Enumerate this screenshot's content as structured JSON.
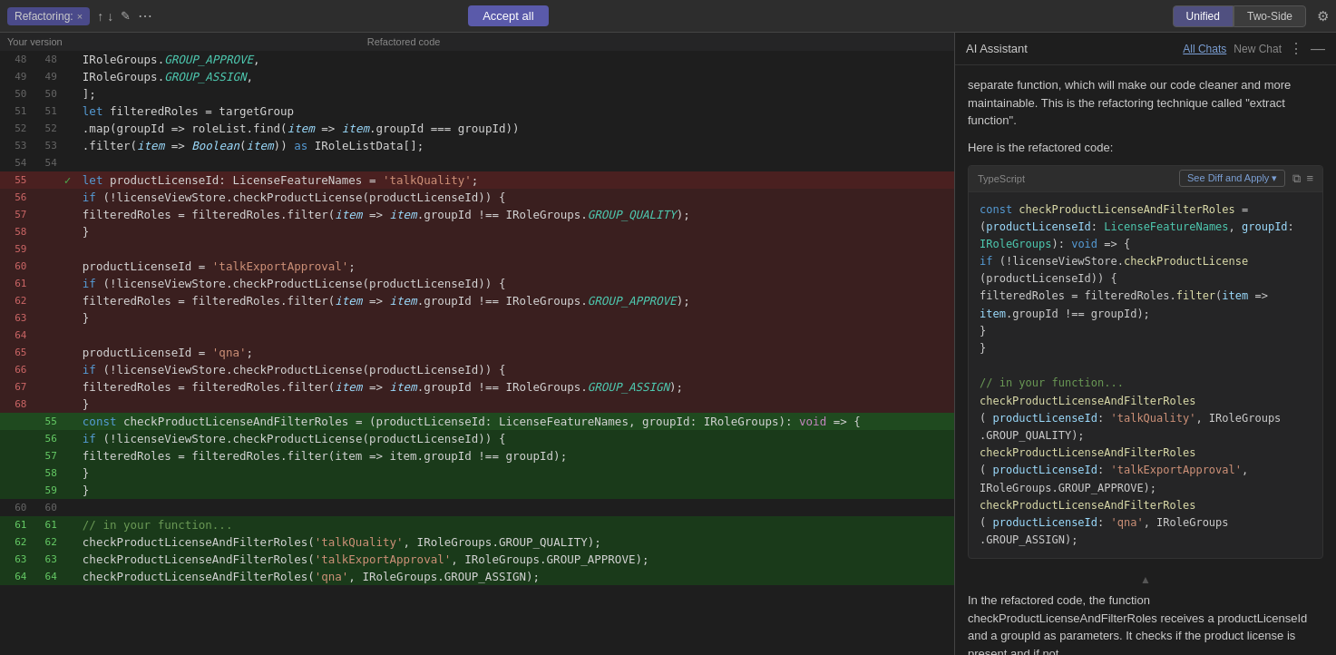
{
  "topbar": {
    "tab_label": "Refactoring:",
    "close_label": "×",
    "accept_all_label": "Accept all",
    "view_unified": "Unified",
    "view_two_side": "Two-Side",
    "active_view": "unified",
    "dots_icon": "⋯"
  },
  "editor": {
    "your_version_label": "Your version",
    "refactored_label": "Refactored code",
    "lines": [
      {
        "old": "48",
        "new": "48",
        "type": "normal",
        "text": "    IRoleGroups.<i>GROUP_APPROVE</i>,"
      },
      {
        "old": "49",
        "new": "49",
        "type": "normal",
        "text": "    IRoleGroups.<i>GROUP_ASSIGN</i>,"
      },
      {
        "old": "50",
        "new": "50",
        "type": "normal",
        "text": "  ];"
      },
      {
        "old": "51",
        "new": "51",
        "type": "normal",
        "text": "  <kw>let</kw> filteredRoles = targetGroup"
      },
      {
        "old": "52",
        "new": "52",
        "type": "normal",
        "text": "    .map(groupId => roleList.find(<i>item</i> => <i>item</i>.groupId === groupId))"
      },
      {
        "old": "53",
        "new": "53",
        "type": "normal",
        "text": "    .filter(<i>item</i> => <i>Boolean</i>(<i>item</i>)) <kw>as</kw> IRoleListData[];"
      },
      {
        "old": "54",
        "new": "54",
        "type": "normal",
        "text": ""
      },
      {
        "old": "55",
        "new": "",
        "type": "removed-bright",
        "check": true,
        "text": "  <kw>let</kw> productLicenseId: LicenseFeatureNames = <str>'talkQuality'</str>;"
      },
      {
        "old": "56",
        "new": "",
        "type": "removed",
        "text": "  <kw>if</kw> (!licenseViewStore.checkProductLicense(productLicenseId)) {"
      },
      {
        "old": "57",
        "new": "",
        "type": "removed",
        "text": "    filteredRoles = filteredRoles.filter(<i>item</i> => <i>item</i>.groupId !== IRoleGroups.<italic2>GROUP_QUALITY</italic2>);"
      },
      {
        "old": "58",
        "new": "",
        "type": "removed",
        "text": "  }"
      },
      {
        "old": "59",
        "new": "",
        "type": "removed",
        "text": ""
      },
      {
        "old": "60",
        "new": "",
        "type": "removed",
        "text": "  productLicenseId = <str>'talkExportApproval'</str>;"
      },
      {
        "old": "61",
        "new": "",
        "type": "removed",
        "text": "  <kw>if</kw> (!licenseViewStore.checkProductLicense(productLicenseId)) {"
      },
      {
        "old": "62",
        "new": "",
        "type": "removed",
        "text": "    filteredRoles = filteredRoles.filter(<i>item</i> => <i>item</i>.groupId !== IRoleGroups.<italic2>GROUP_APPROVE</italic2>);"
      },
      {
        "old": "63",
        "new": "",
        "type": "removed",
        "text": "  }"
      },
      {
        "old": "64",
        "new": "",
        "type": "removed",
        "text": ""
      },
      {
        "old": "65",
        "new": "",
        "type": "removed",
        "text": "  productLicenseId = <str>'qna'</str>;"
      },
      {
        "old": "66",
        "new": "",
        "type": "removed",
        "text": "  <kw>if</kw> (!licenseViewStore.checkProductLicense(productLicenseId)) {"
      },
      {
        "old": "67",
        "new": "",
        "type": "removed",
        "text": "    filteredRoles = filteredRoles.filter(<i>item</i> => <i>item</i>.groupId !== IRoleGroups.<italic2>GROUP_ASSIGN</italic2>);"
      },
      {
        "old": "68",
        "new": "",
        "type": "removed",
        "text": "  }"
      },
      {
        "old": "",
        "new": "55",
        "type": "added-bright",
        "text": "  <kw>const</kw> checkProductLicenseAndFilterRoles = (productLicenseId: LicenseFeatureNames, groupId: IRoleGroups): <kw2>void</kw2> => {"
      },
      {
        "old": "",
        "new": "56",
        "type": "added",
        "text": "    <kw>if</kw> (!licenseViewStore.checkProductLicense(productLicenseId)) {"
      },
      {
        "old": "",
        "new": "57",
        "type": "added",
        "text": "      filteredRoles = filteredRoles.filter(item => item.groupId !== groupId);"
      },
      {
        "old": "",
        "new": "58",
        "type": "added",
        "text": "    }"
      },
      {
        "old": "",
        "new": "59",
        "type": "added",
        "text": "  }"
      },
      {
        "old": "60",
        "new": "60",
        "type": "normal",
        "text": ""
      },
      {
        "old": "61",
        "new": "61",
        "type": "added-line",
        "text": "  <comment>// in your function...</comment>"
      },
      {
        "old": "62",
        "new": "62",
        "type": "added-line",
        "text": "  checkProductLicenseAndFilterRoles(<str>'talkQuality'</str>, IRoleGroups.GROUP_QUALITY);"
      },
      {
        "old": "63",
        "new": "63",
        "type": "added-line",
        "text": "  checkProductLicenseAndFilterRoles(<str>'talkExportApproval'</str>, IRoleGroups.GROUP_APPROVE);"
      },
      {
        "old": "64",
        "new": "64",
        "type": "added-line",
        "text": "  checkProductLicenseAndFilterRoles(<str>'qna'</str>, IRoleGroups.GROUP_ASSIGN);"
      }
    ]
  },
  "ai_panel": {
    "title": "AI Assistant",
    "all_chats_label": "All Chats",
    "new_chat_label": "New Chat",
    "code_lang": "TypeScript",
    "see_diff_label": "See Diff and Apply",
    "text_before_code": "separate function, which will make our code cleaner and more maintainable. This is the refactoring technique called \"extract function\".",
    "text_here_is": "Here is the refactored code:",
    "code_lines": [
      "const checkProductLicenseAndFilterRoles =",
      "  (productLicenseId: LicenseFeatureNames, groupId:",
      "   IRoleGroups): void => {",
      "  if (!licenseViewStore.checkProductLicense",
      "    (productLicenseId)) {",
      "    filteredRoles = filteredRoles.filter(item =>",
      "      item.groupId !== groupId);",
      "  }",
      "}"
    ],
    "comment_line": "// in your function...",
    "call_lines": [
      "checkProductLicenseAndFilterRoles",
      "  ( productLicenseId: 'talkQuality', IRoleGroups",
      "  .GROUP_QUALITY);",
      "checkProductLicenseAndFilterRoles",
      "  ( productLicenseId: 'talkExportApproval',",
      "  IRoleGroups.GROUP_APPROVE);",
      "checkProductLicenseAndFilterRoles",
      "  ( productLicenseId: 'qna', IRoleGroups",
      "  .GROUP_ASSIGN);"
    ],
    "text_after": "In the refactored code, the function checkProductLicenseAndFilterRoles receives a productLicenseId and a groupId as parameters. It checks if the product license is present and if not,"
  }
}
